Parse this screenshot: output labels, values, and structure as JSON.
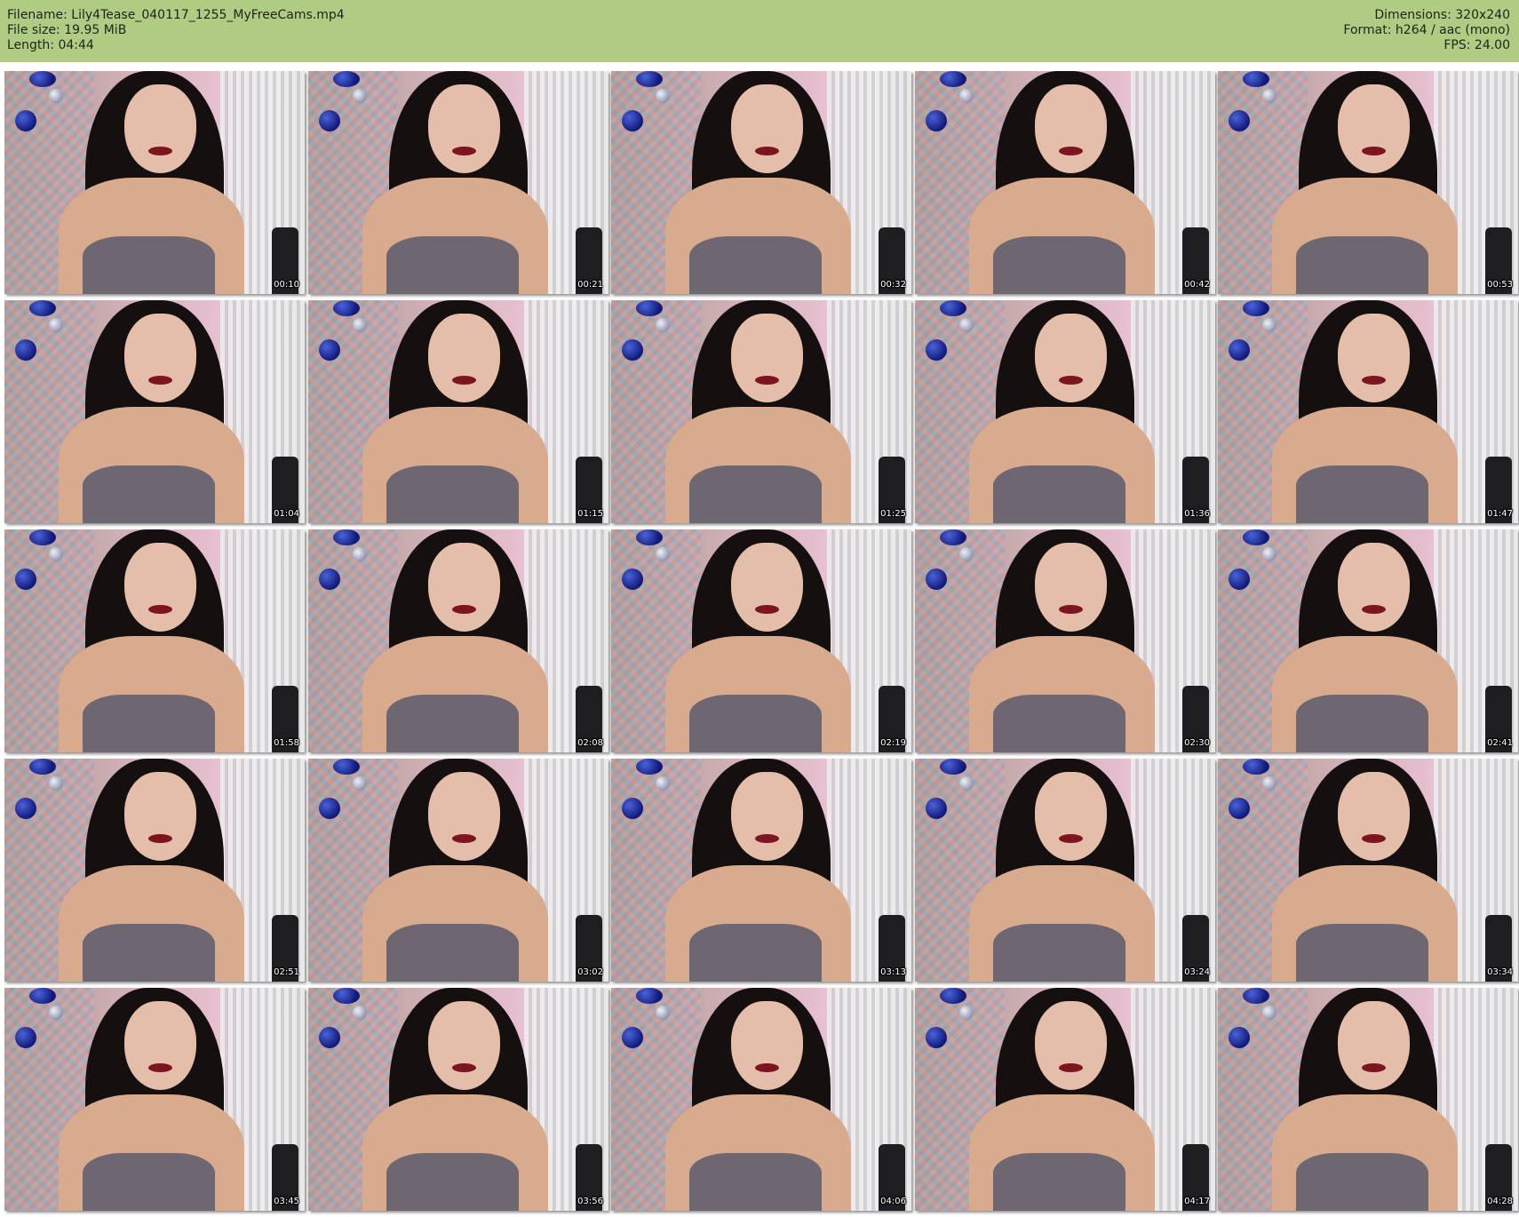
{
  "header": {
    "filename": "Filename: Lily4Tease_040117_1255_MyFreeCams.mp4",
    "filesize": "File size: 19.95 MiB",
    "length": "Length: 04:44",
    "dimensions": "Dimensions: 320x240",
    "format": "Format: h264 / aac (mono)",
    "fps": "FPS: 24.00"
  },
  "thumbnails": [
    {
      "timestamp": "00:10"
    },
    {
      "timestamp": "00:21"
    },
    {
      "timestamp": "00:32"
    },
    {
      "timestamp": "00:42"
    },
    {
      "timestamp": "00:53"
    },
    {
      "timestamp": "01:04"
    },
    {
      "timestamp": "01:15"
    },
    {
      "timestamp": "01:25"
    },
    {
      "timestamp": "01:36"
    },
    {
      "timestamp": "01:47"
    },
    {
      "timestamp": "01:58"
    },
    {
      "timestamp": "02:08"
    },
    {
      "timestamp": "02:19"
    },
    {
      "timestamp": "02:30"
    },
    {
      "timestamp": "02:41"
    },
    {
      "timestamp": "02:51"
    },
    {
      "timestamp": "03:02"
    },
    {
      "timestamp": "03:13"
    },
    {
      "timestamp": "03:24"
    },
    {
      "timestamp": "03:34"
    },
    {
      "timestamp": "03:45"
    },
    {
      "timestamp": "03:56"
    },
    {
      "timestamp": "04:06"
    },
    {
      "timestamp": "04:17"
    },
    {
      "timestamp": "04:28"
    }
  ],
  "colors": {
    "header_bg": "#b0cc84",
    "page_bg": "#ffffff"
  }
}
